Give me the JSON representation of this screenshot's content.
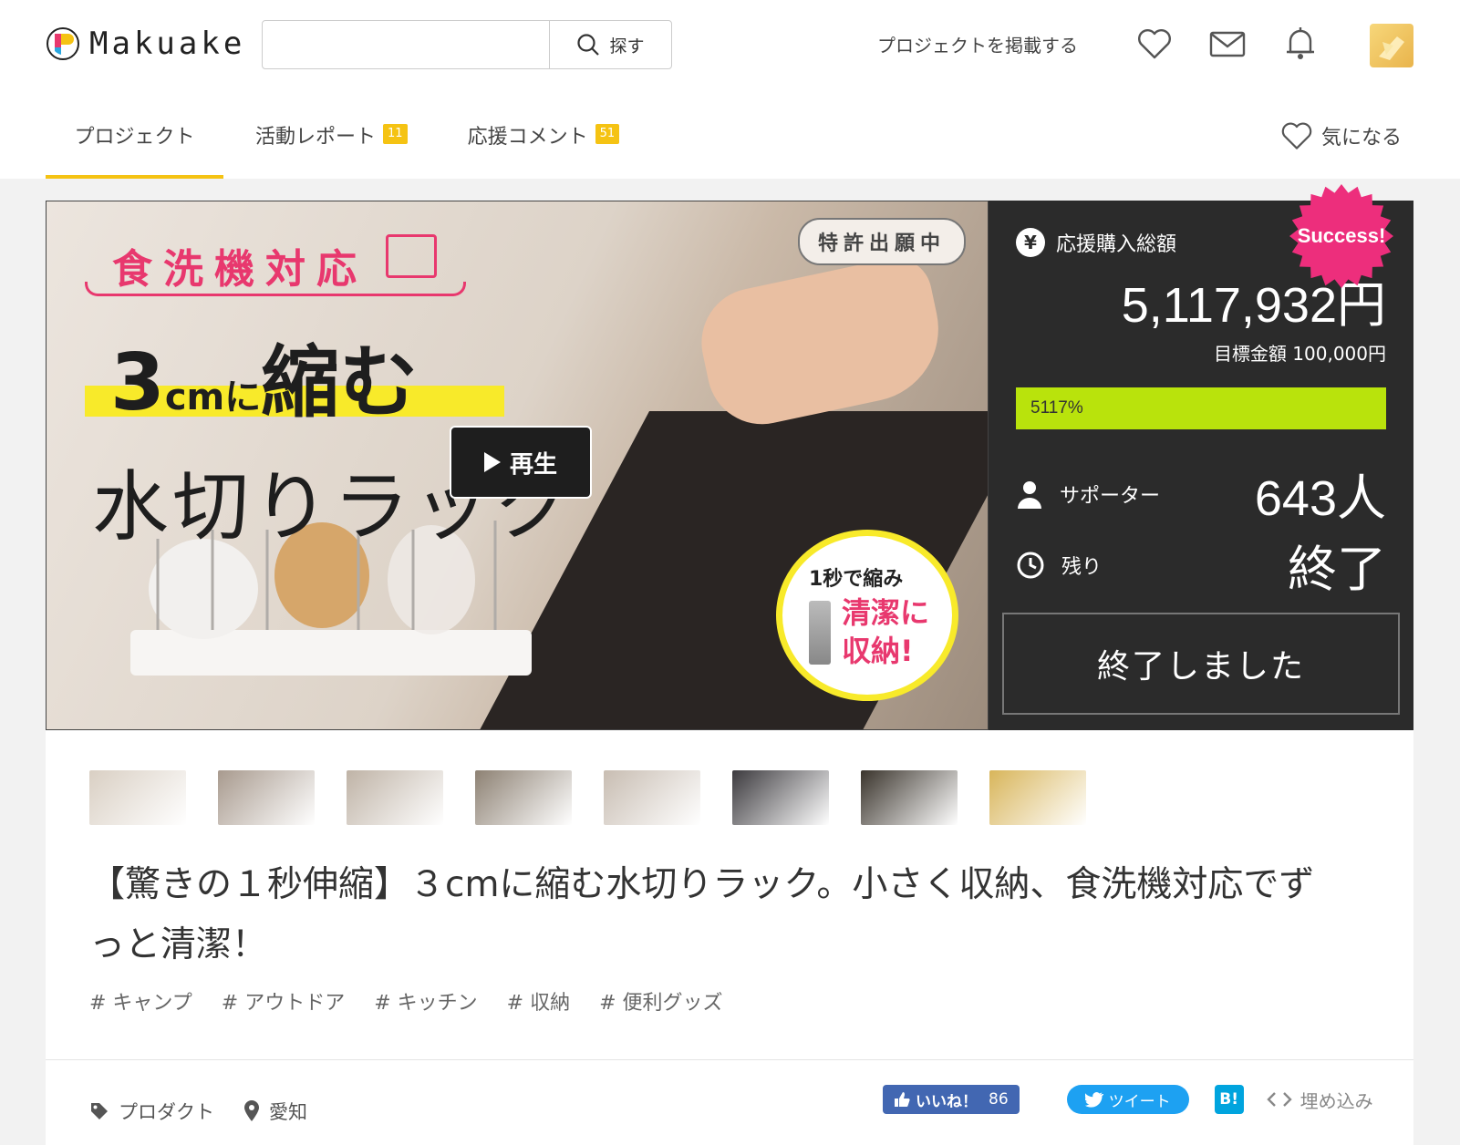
{
  "header": {
    "logo_text": "Makuake",
    "search_placeholder": "",
    "search_button": "探す",
    "post_project": "プロジェクトを掲載する",
    "icons": [
      "heart-icon",
      "mail-icon",
      "bell-icon"
    ]
  },
  "tabs": [
    {
      "label": "プロジェクト",
      "badge": "",
      "active": true
    },
    {
      "label": "活動レポート",
      "badge": "11",
      "active": false
    },
    {
      "label": "応援コメント",
      "badge": "51",
      "active": false
    }
  ],
  "favorite_label": "気になる",
  "hero": {
    "dishwasher_text": "食洗機対応",
    "patent_text": "特許出願中",
    "headline_num": "3",
    "headline_unit": "cm",
    "headline_ni": "に",
    "headline_verb": "縮む",
    "headline_line2": "水切りラック",
    "play_label": "再生",
    "bubble_line1": "1秒で縮み",
    "bubble_line2": "清潔に",
    "bubble_line3": "収納!"
  },
  "panel": {
    "total_label": "応援購入総額",
    "total_amount": "5,117,932円",
    "target_text": "目標金額 100,000円",
    "progress_text": "5117%",
    "progress_fraction": 1.0,
    "supporters_label": "サポーター",
    "supporters_value": "643人",
    "remaining_label": "残り",
    "remaining_value": "終了",
    "ended_button": "終了しました",
    "success_badge": "Success!"
  },
  "thumbnails": [
    {
      "name": "thumb-1",
      "color": "#d9cfc3"
    },
    {
      "name": "thumb-2",
      "color": "#a89a8e"
    },
    {
      "name": "thumb-3",
      "color": "#bfb3a6"
    },
    {
      "name": "thumb-4",
      "color": "#8d8173"
    },
    {
      "name": "thumb-5",
      "color": "#c8bdb2"
    },
    {
      "name": "thumb-6",
      "color": "#3c3a3e"
    },
    {
      "name": "thumb-7",
      "color": "#3a342c"
    },
    {
      "name": "thumb-8",
      "color": "#d8b55a"
    }
  ],
  "project_title": "【驚きの１秒伸縮】３cmに縮む水切りラック。小さく収納、食洗機対応でずっと清潔！",
  "tags": [
    "# キャンプ",
    "# アウトドア",
    "# キッチン",
    "# 収納",
    "# 便利グッズ"
  ],
  "meta": {
    "category": "プロダクト",
    "location": "愛知"
  },
  "share": {
    "like_label": "いいね！",
    "like_count": "86",
    "tweet_label": "ツイート",
    "hatena_label": "B!",
    "embed_label": "埋め込み"
  },
  "colors": {
    "accent_yellow": "#f5c313",
    "progress_green": "#b9e30c",
    "success_pink": "#ed2e7c",
    "panel_dark": "#2b2b2b"
  }
}
